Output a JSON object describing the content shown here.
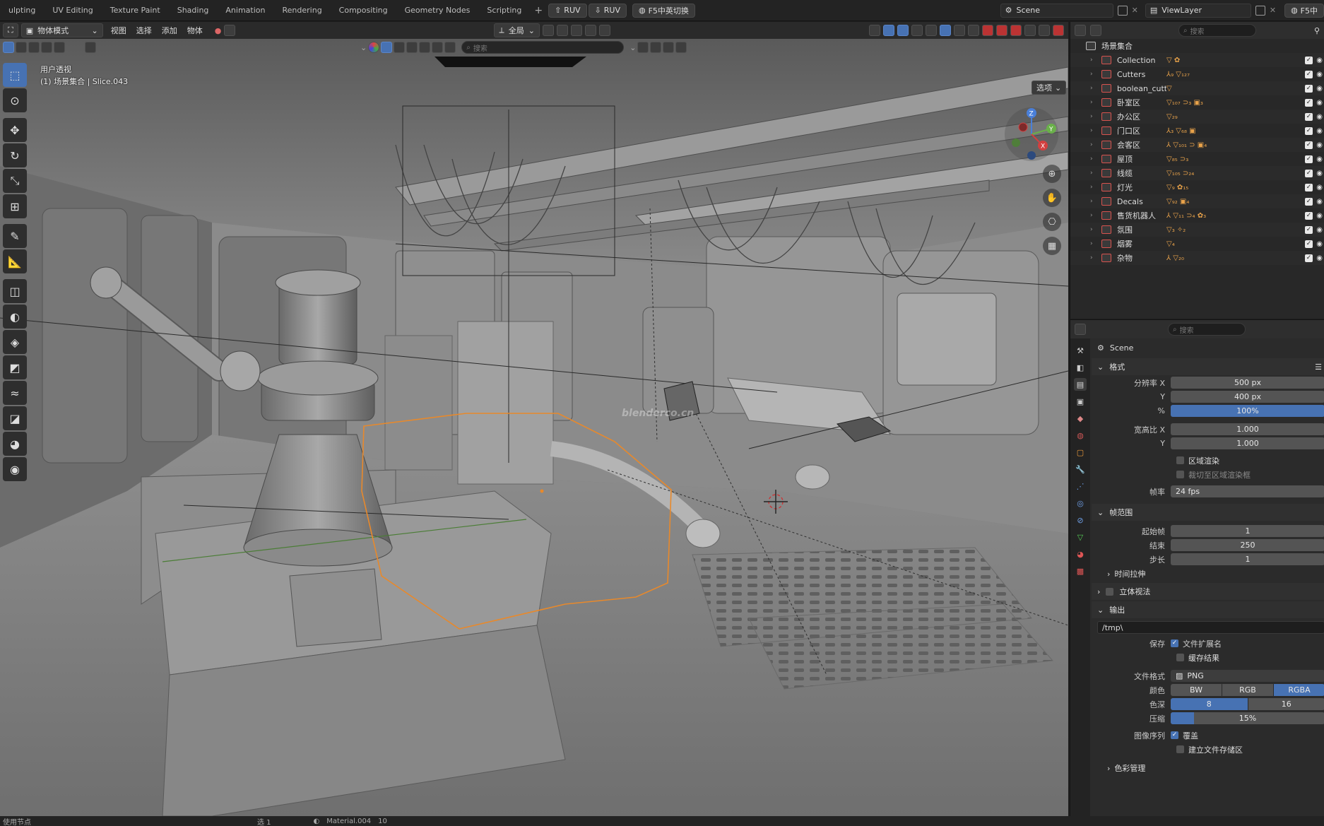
{
  "workspaces": [
    "ulpting",
    "UV Editing",
    "Texture Paint",
    "Shading",
    "Animation",
    "Rendering",
    "Compositing",
    "Geometry Nodes",
    "Scripting"
  ],
  "top": {
    "add_symbol": "+",
    "ruv1": "RUV",
    "ruv2": "RUV",
    "f5_switch": "F5中英切换",
    "scene": "Scene",
    "view_layer": "ViewLayer",
    "f5_right": "F5中"
  },
  "vp_header": {
    "mode": "物体模式",
    "menus": [
      "视图",
      "选择",
      "添加",
      "物体"
    ],
    "orientation": "全局",
    "search_placeholder": "搜索",
    "options": "选项"
  },
  "viewport": {
    "view_name": "用户透视",
    "context": "(1) 场景集合 | Slice.043",
    "watermark": "blenderco.cn"
  },
  "outliner": {
    "search_placeholder": "搜索",
    "root": "场景集合",
    "rows": [
      {
        "name": "Collection",
        "extra": "▽ ✿"
      },
      {
        "name": "Cutters",
        "extra": "⅄₉ ▽₁₂₇"
      },
      {
        "name": "boolean_cutters",
        "extra": "▽"
      },
      {
        "name": "卧室区",
        "extra": "▽₁₀₇ ⊃₃ ▣₃"
      },
      {
        "name": "办公区",
        "extra": "▽₂₉"
      },
      {
        "name": "门口区",
        "extra": "⅄₃ ▽₆₈ ▣"
      },
      {
        "name": "会客区",
        "extra": "⅄ ▽₁₀₁ ⊃ ▣₄"
      },
      {
        "name": "屋顶",
        "extra": "▽₈₅ ⊃₃"
      },
      {
        "name": "线缆",
        "extra": "▽₁₀₅ ⊃₂₄"
      },
      {
        "name": "灯光",
        "extra": "▽₉ ✿₁₅"
      },
      {
        "name": "Decals",
        "extra": "▽₉₂ ▣₄"
      },
      {
        "name": "售货机器人",
        "extra": "⅄ ▽₁₁ ⊃₄ ✿₃"
      },
      {
        "name": "氛围",
        "extra": "▽₃ ✧₂"
      },
      {
        "name": "烟雾",
        "extra": "▽₄"
      },
      {
        "name": "杂物",
        "extra": "⅄ ▽₂₀"
      }
    ]
  },
  "properties": {
    "search_placeholder": "搜索",
    "breadcrumb": "Scene",
    "format": {
      "title": "格式",
      "res_x_label": "分辨率 X",
      "res_x": "500 px",
      "res_y_label": "Y",
      "res_y": "400 px",
      "pct_label": "%",
      "pct": "100%",
      "aspect_x_label": "宽高比 X",
      "aspect_x": "1.000",
      "aspect_y_label": "Y",
      "aspect_y": "1.000",
      "region_render": "区域渲染",
      "crop_region": "裁切至区域渲染框",
      "fps_label": "帧率",
      "fps": "24 fps"
    },
    "frame_range": {
      "title": "帧范围",
      "start_label": "起始帧",
      "start": "1",
      "end_label": "结束",
      "end": "250",
      "step_label": "步长",
      "step": "1",
      "time_stretch": "时间拉伸"
    },
    "stereoscopy": "立体视法",
    "output": {
      "title": "输出",
      "path": "/tmp\\",
      "save_label": "保存",
      "file_ext": "文件扩展名",
      "cache_result": "缓存结果",
      "file_format_label": "文件格式",
      "file_format": "PNG",
      "color_label": "颜色",
      "color_bw": "BW",
      "color_rgb": "RGB",
      "color_rgba": "RGBA",
      "depth_label": "色深",
      "depth_8": "8",
      "depth_16": "16",
      "compression_label": "压缩",
      "compression": "15%",
      "compression_fraction": 0.15,
      "image_seq_label": "图像序列",
      "overwrite": "覆盖",
      "placeholders": "建立文件存储区",
      "color_mgmt": "色彩管理"
    }
  },
  "statusbar": {
    "left": "使用节点",
    "mid1": "选 1",
    "material": "Material.004",
    "num": "10"
  },
  "colors": {
    "accent_blue": "#4772b3",
    "selection_orange": "#e8892b",
    "viewport_gray": "#7d7d7d"
  }
}
